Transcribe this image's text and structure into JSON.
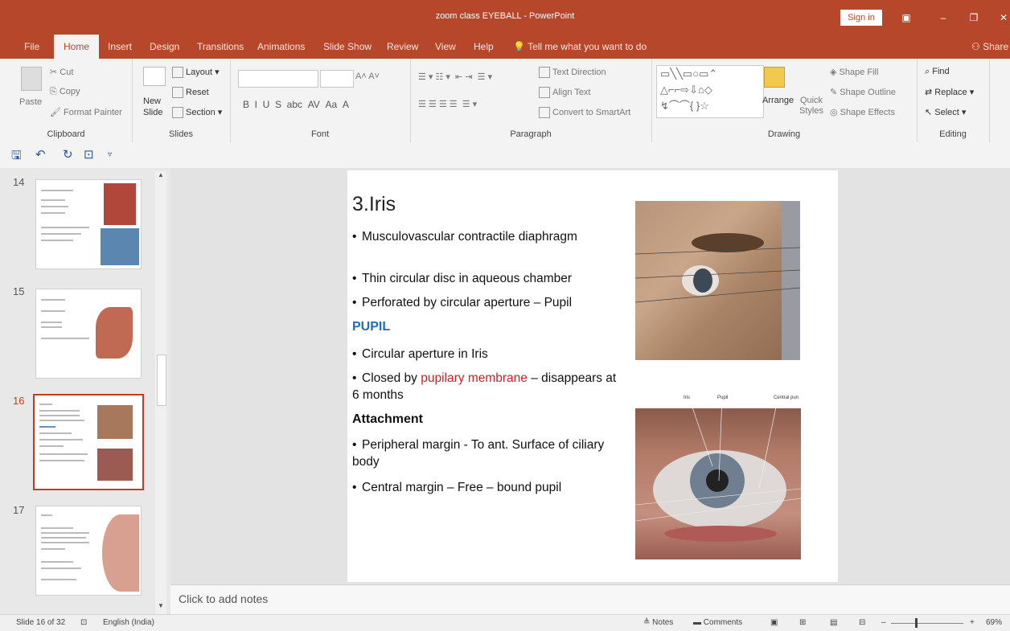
{
  "window": {
    "title": "zoom class EYEBALL  -  PowerPoint",
    "sign_in": "Sign in"
  },
  "tabs": [
    "File",
    "Home",
    "Insert",
    "Design",
    "Transitions",
    "Animations",
    "Slide Show",
    "Review",
    "View",
    "Help"
  ],
  "active_tab": "Home",
  "tell_me": "Tell me what you want to do",
  "share": "Share",
  "ribbon": {
    "clipboard": {
      "label": "Clipboard",
      "paste": "Paste",
      "cut": "Cut",
      "copy": "Copy",
      "format_painter": "Format Painter"
    },
    "slides": {
      "label": "Slides",
      "new_slide": "New Slide",
      "layout": "Layout",
      "reset": "Reset",
      "section": "Section"
    },
    "font": {
      "label": "Font"
    },
    "paragraph": {
      "label": "Paragraph",
      "text_direction": "Text Direction",
      "align_text": "Align Text",
      "convert": "Convert to SmartArt"
    },
    "drawing": {
      "label": "Drawing",
      "arrange": "Arrange",
      "quick_styles": "Quick Styles",
      "shape_fill": "Shape Fill",
      "shape_outline": "Shape Outline",
      "shape_effects": "Shape Effects"
    },
    "editing": {
      "label": "Editing",
      "find": "Find",
      "replace": "Replace",
      "select": "Select"
    }
  },
  "thumbnails": [
    {
      "num": "14"
    },
    {
      "num": "15"
    },
    {
      "num": "16"
    },
    {
      "num": "17"
    }
  ],
  "slide": {
    "title": "3.Iris",
    "bullets1": [
      "Musculovascular contractile diaphragm",
      "Thin circular disc in aqueous chamber",
      "Perforated by circular aperture – Pupil"
    ],
    "pupil_heading": "PUPIL",
    "pupil_b1": "Circular aperture in Iris",
    "pupil_b2_pre": "Closed by ",
    "pupil_b2_red": "pupilary membrane",
    "pupil_b2_post": " – disappears at 6 months",
    "attach_heading": "Attachment",
    "attach_b1": "Peripheral margin  - To ant. Surface of ciliary body",
    "attach_b2": "Central margin – Free – bound pupil",
    "img2_labels": [
      "Iris",
      "Pupil",
      "Central pun"
    ]
  },
  "notes_placeholder": "Click to add notes",
  "status": {
    "slide_info": "Slide 16 of 32",
    "language": "English (India)",
    "notes": "Notes",
    "comments": "Comments",
    "zoom": "69%"
  },
  "colors": {
    "accent": "#b7472a",
    "pupil_heading": "#1f6fb5",
    "red_text": "#d0202a"
  }
}
